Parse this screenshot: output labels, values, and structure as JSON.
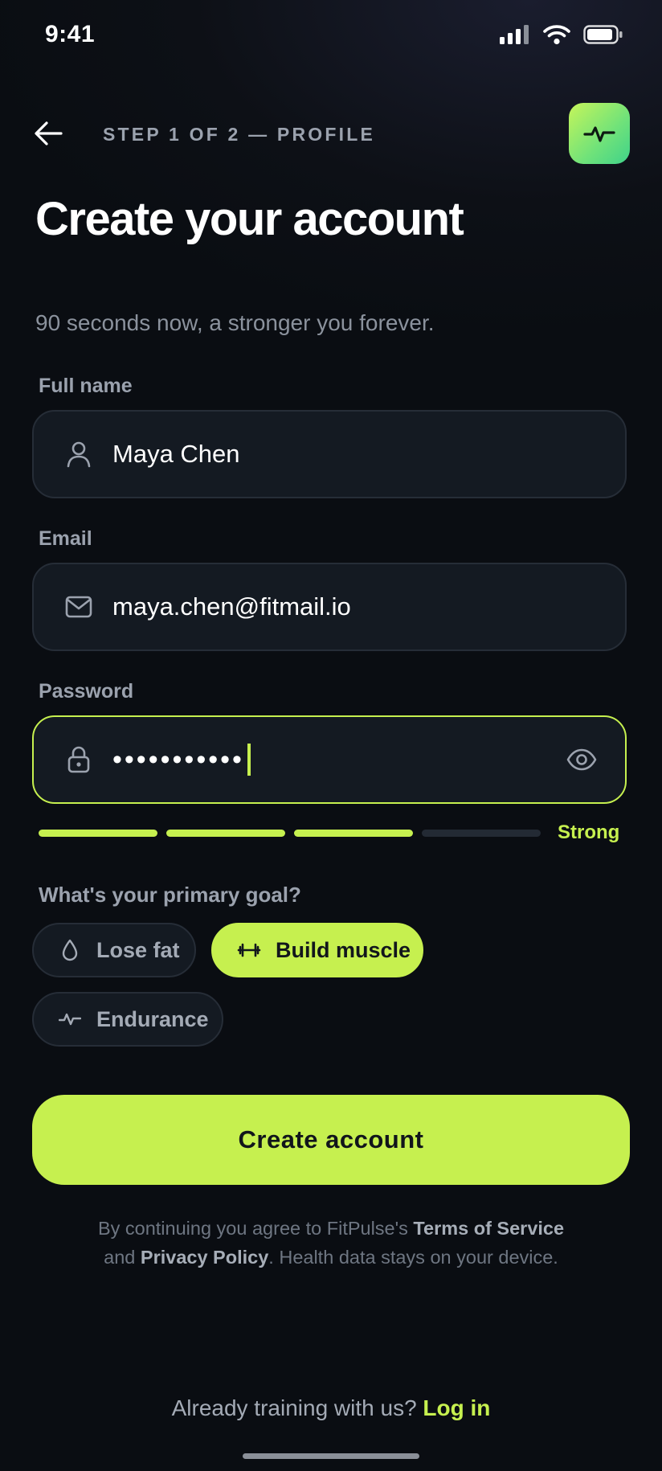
{
  "status_bar": {
    "time": "9:41"
  },
  "header": {
    "step_label": "STEP 1 OF 2 — PROFILE",
    "title": "Create your account",
    "subtitle": "90 seconds now, a stronger you forever."
  },
  "form": {
    "full_name": {
      "label": "Full name",
      "value": "Maya Chen",
      "icon": "person-icon"
    },
    "email": {
      "label": "Email",
      "value": "maya.chen@fitmail.io",
      "icon": "mail-icon"
    },
    "password": {
      "label": "Password",
      "masked_value": "•••••••••••",
      "icon": "lock-icon",
      "toggle_icon": "eye-icon",
      "focused": true
    },
    "strength": {
      "segments_total": 4,
      "segments_filled": 3,
      "label": "Strong"
    }
  },
  "goal": {
    "question": "What's your primary goal?",
    "options": [
      {
        "label": "Lose fat",
        "icon": "droplet-icon",
        "selected": false
      },
      {
        "label": "Build muscle",
        "icon": "dumbbell-icon",
        "selected": true
      },
      {
        "label": "Endurance",
        "icon": "pulse-icon",
        "selected": false
      }
    ]
  },
  "cta": {
    "label": "Create account"
  },
  "legal": {
    "prefix": "By continuing you agree to FitPulse's ",
    "terms_link": "Terms of Service",
    "middle": "and ",
    "privacy_link": "Privacy Policy",
    "suffix": ". Health data stays on your device."
  },
  "footer": {
    "prompt": "Already training with us? ",
    "login_link": "Log in"
  },
  "colors": {
    "accent": "#c6f04f",
    "background": "#0b0e13",
    "field_bg": "#141a22",
    "field_border": "#262d37",
    "muted_text": "#9ba2ae"
  }
}
